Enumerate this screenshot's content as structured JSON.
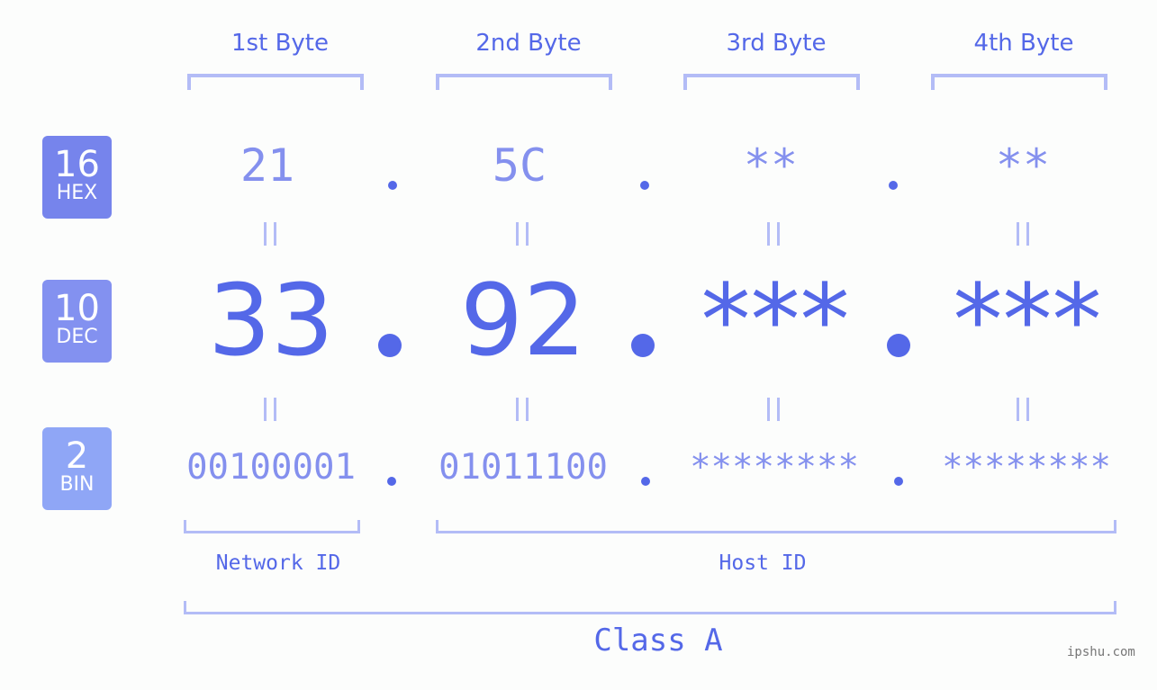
{
  "headers": [
    "1st Byte",
    "2nd Byte",
    "3rd Byte",
    "4th Byte"
  ],
  "badges": [
    {
      "num": "16",
      "label": "HEX",
      "color": "#7684ec"
    },
    {
      "num": "10",
      "label": "DEC",
      "color": "#8391f0"
    },
    {
      "num": "2",
      "label": "BIN",
      "color": "#8fa6f6"
    }
  ],
  "hex": [
    "21",
    "5C",
    "**",
    "**"
  ],
  "dec": [
    "33",
    "92",
    "***",
    "***"
  ],
  "bin": [
    "00100001",
    "01011100",
    "********",
    "********"
  ],
  "equals": "=",
  "network_label": "Network ID",
  "host_label": "Host ID",
  "class_label": "Class A",
  "watermark": "ipshu.com"
}
